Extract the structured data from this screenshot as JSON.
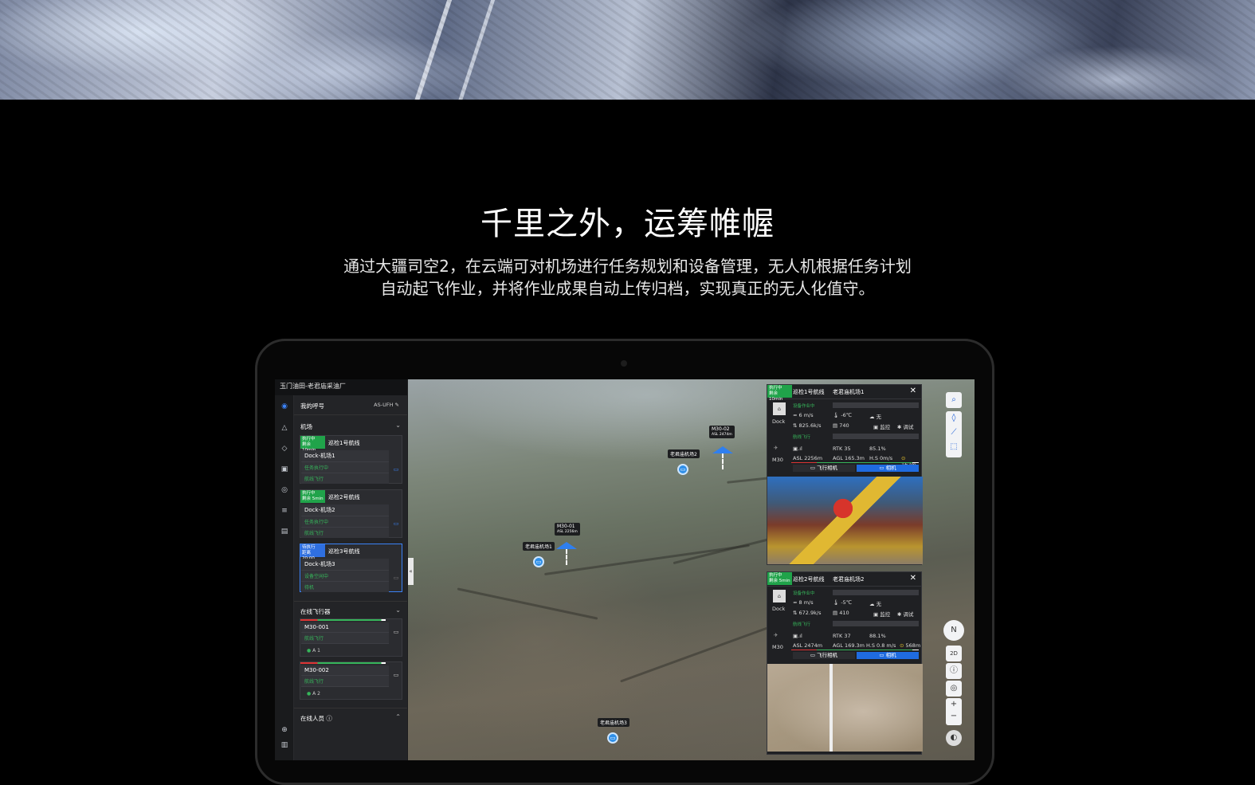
{
  "hero_alt": "",
  "section": {
    "title": "千里之外，运筹帷幄",
    "subtitle_line1": "通过大疆司空2，在云端可对机场进行任务规划和设备管理，无人机根据任务计划",
    "subtitle_line2": "自动起飞作业，并将作业成果自动上传归档，实现真正的无人化值守。"
  },
  "app": {
    "header_title": "玉门油田-老君庙采油厂",
    "callsign_label": "我的呼号",
    "callsign_value": "AS-UFH",
    "docks_section": "机场",
    "docks": [
      {
        "status": "执行中",
        "status_sub": "剩余 10min",
        "mission": "巡检1号航线",
        "name": "Dock-机场1",
        "line1": "任务执行中",
        "line2": "航线飞行"
      },
      {
        "status": "执行中",
        "status_sub": "剩余 5min",
        "mission": "巡检2号航线",
        "name": "Dock-机场2",
        "line1": "任务执行中",
        "line2": "航线飞行"
      },
      {
        "status": "待执行",
        "status_sub": "距离 20:00",
        "mission": "巡检3号航线",
        "name": "Dock-机场3",
        "line1": "设备空闲中",
        "line2": "待机"
      }
    ],
    "aircraft_section": "在线飞行器",
    "aircraft": [
      {
        "name": "M30-001",
        "mode": "航线飞行",
        "pilot": "A 1"
      },
      {
        "name": "M30-002",
        "mode": "航线飞行",
        "pilot": "A 2"
      }
    ],
    "people_section": "在线人员",
    "map": {
      "dock_labels": [
        "老君庙机场1",
        "老君庙机场2",
        "老君庙机场3"
      ],
      "drones": [
        {
          "name": "M30-01",
          "asl": "ASL 2256m"
        },
        {
          "name": "M30-02",
          "asl": "ASL 2474m"
        }
      ],
      "collapse_glyph": "«",
      "compass": "N",
      "mode_2d": "2D",
      "zoom_in": "+",
      "zoom_out": "−"
    },
    "panels": [
      {
        "status": "执行中",
        "status_sub": "剩余 10min",
        "mission": "巡检1号航线",
        "dock": "老君庙机场1",
        "close": "✕",
        "dock_label": "Dock",
        "device_state": "设备作业中",
        "wind": "6 m/s",
        "temp": "-6℃",
        "rain": "无",
        "net": "825.6k/s",
        "storage": "740",
        "monitor": "监控",
        "debug": "调试",
        "flight_state": "航线飞行",
        "aircraft_label": "M30",
        "rtk": "RTK 35",
        "battery": "85.1%",
        "asl": "ASL  2256m",
        "agl": "AGL  165.3m",
        "hs": "H.S 0m/s",
        "dist": "162m",
        "cam_fpv": "飞行相机",
        "cam_main": "相机"
      },
      {
        "status": "执行中",
        "status_sub": "剩余 5min",
        "mission": "巡检2号航线",
        "dock": "老君庙机场2",
        "close": "✕",
        "dock_label": "Dock",
        "device_state": "设备作业中",
        "wind": "8 m/s",
        "temp": "-5℃",
        "rain": "无",
        "net": "672.9k/s",
        "storage": "410",
        "monitor": "监控",
        "debug": "调试",
        "flight_state": "航线飞行",
        "aircraft_label": "M30",
        "rtk": "RTK 37",
        "battery": "88.1%",
        "asl": "ASL  2474m",
        "agl": "AGL  169.3m",
        "hs": "H.S 0.8 m/s",
        "dist": "568m",
        "cam_fpv": "飞行相机",
        "cam_main": "相机"
      }
    ]
  },
  "colors": {
    "green": "#20a34a",
    "blue": "#2f6fe0",
    "accent": "#3b82f6"
  }
}
